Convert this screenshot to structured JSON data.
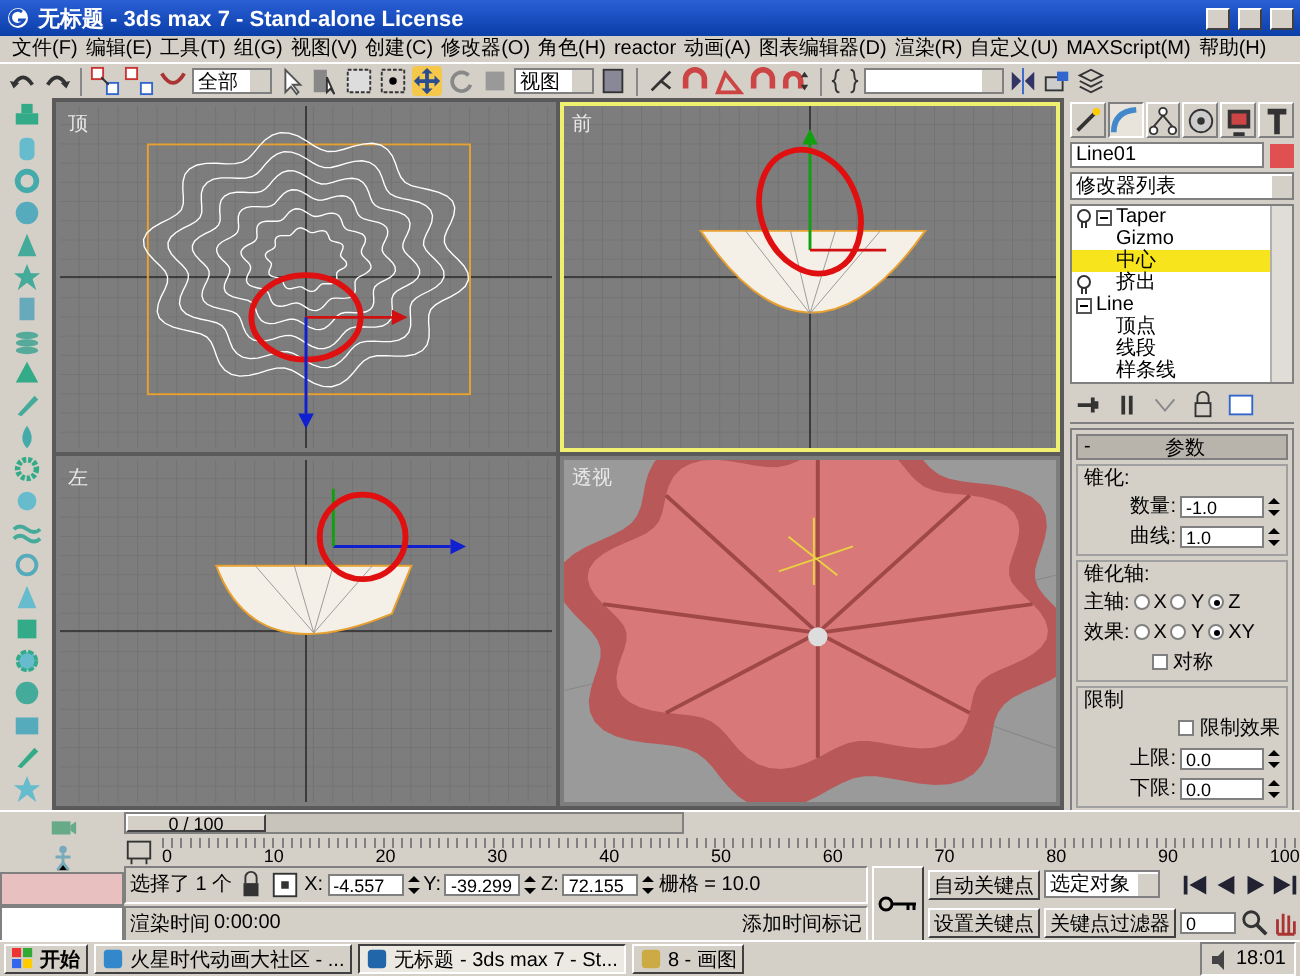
{
  "window": {
    "title": "无标题 - 3ds max 7 - Stand-alone License"
  },
  "menu": [
    "文件(F)",
    "编辑(E)",
    "工具(T)",
    "组(G)",
    "视图(V)",
    "创建(C)",
    "修改器(O)",
    "角色(H)",
    "reactor",
    "动画(A)",
    "图表编辑器(D)",
    "渲染(R)",
    "自定义(U)",
    "MAXScript(M)",
    "帮助(H)"
  ],
  "toolbar": {
    "selection_filter": "全部",
    "reference_coord": "视图"
  },
  "viewports": [
    {
      "label": "顶",
      "selected": false,
      "kind": "top"
    },
    {
      "label": "前",
      "selected": true,
      "kind": "front"
    },
    {
      "label": "左",
      "selected": false,
      "kind": "left"
    },
    {
      "label": "透视",
      "selected": false,
      "kind": "perspective"
    }
  ],
  "command_panel": {
    "tabs": [
      {
        "selected": false
      },
      {
        "selected": true
      },
      {
        "selected": false
      },
      {
        "selected": false
      },
      {
        "selected": false
      },
      {
        "selected": false
      }
    ],
    "object": {
      "name": "Line01",
      "color": "#e05050"
    },
    "modifier_list": "修改器列表",
    "stack": [
      {
        "label": "Taper",
        "kind": "modifier",
        "expanded": true,
        "selected": false,
        "children": [
          {
            "label": "Gizmo",
            "selected": false
          },
          {
            "label": "中心",
            "selected": true
          }
        ]
      },
      {
        "label": "挤出",
        "kind": "modifier",
        "selected": false
      },
      {
        "label": "Line",
        "kind": "base",
        "expanded": true,
        "selected": false,
        "children": [
          {
            "label": "顶点",
            "selected": false
          },
          {
            "label": "线段",
            "selected": false
          },
          {
            "label": "样条线",
            "selected": false
          }
        ]
      }
    ],
    "rollout": {
      "sign": "-",
      "title": "参数",
      "taper": {
        "title": "锥化:",
        "fields": [
          {
            "label": "数量:",
            "value": "-1.0"
          },
          {
            "label": "曲线:",
            "value": "1.0"
          }
        ]
      },
      "axis": {
        "title": "锥化轴:",
        "rows": [
          {
            "label": "主轴:",
            "options": [
              {
                "label": "X",
                "selected": false
              },
              {
                "label": "Y",
                "selected": false
              },
              {
                "label": "Z",
                "selected": true
              }
            ]
          },
          {
            "label": "效果:",
            "options": [
              {
                "label": "X",
                "selected": false
              },
              {
                "label": "Y",
                "selected": false
              },
              {
                "label": "XY",
                "selected": true
              }
            ]
          }
        ],
        "symmetry": {
          "label": "对称",
          "checked": false
        }
      },
      "limits": {
        "title": "限制",
        "limit_effect": {
          "label": "限制效果",
          "checked": false
        },
        "fields": [
          {
            "label": "上限:",
            "value": "0.0"
          },
          {
            "label": "下限:",
            "value": "0.0"
          }
        ]
      }
    }
  },
  "timeline": {
    "frame": "0 / 100",
    "level": 0,
    "ticks": [
      "0",
      "10",
      "20",
      "30",
      "40",
      "50",
      "60",
      "70",
      "80",
      "90",
      "100"
    ]
  },
  "status": {
    "selected": "选择了 1 个",
    "coords": [
      {
        "axis": "X:",
        "value": "-4.557"
      },
      {
        "axis": "Y:",
        "value": "-39.299"
      },
      {
        "axis": "Z:",
        "value": "72.155"
      }
    ],
    "grid": "栅格 = 10.0",
    "render_time_label": "渲染时间",
    "render_time": "0:00:00",
    "add_time_tag": "添加时间标记",
    "auto_key": "自动关键点",
    "set_key": "设置关键点",
    "key_target": "选定对象",
    "key_filters": "关键点过滤器",
    "current_frame": "0"
  },
  "taskbar": {
    "start": "开始",
    "tasks": [
      {
        "label": "火星时代动画大社区 - ...",
        "selected": false
      },
      {
        "label": "无标题 - 3ds max 7 - St...",
        "selected": true
      },
      {
        "label": "8 - 画图",
        "selected": false
      }
    ],
    "clock": "18:01"
  }
}
